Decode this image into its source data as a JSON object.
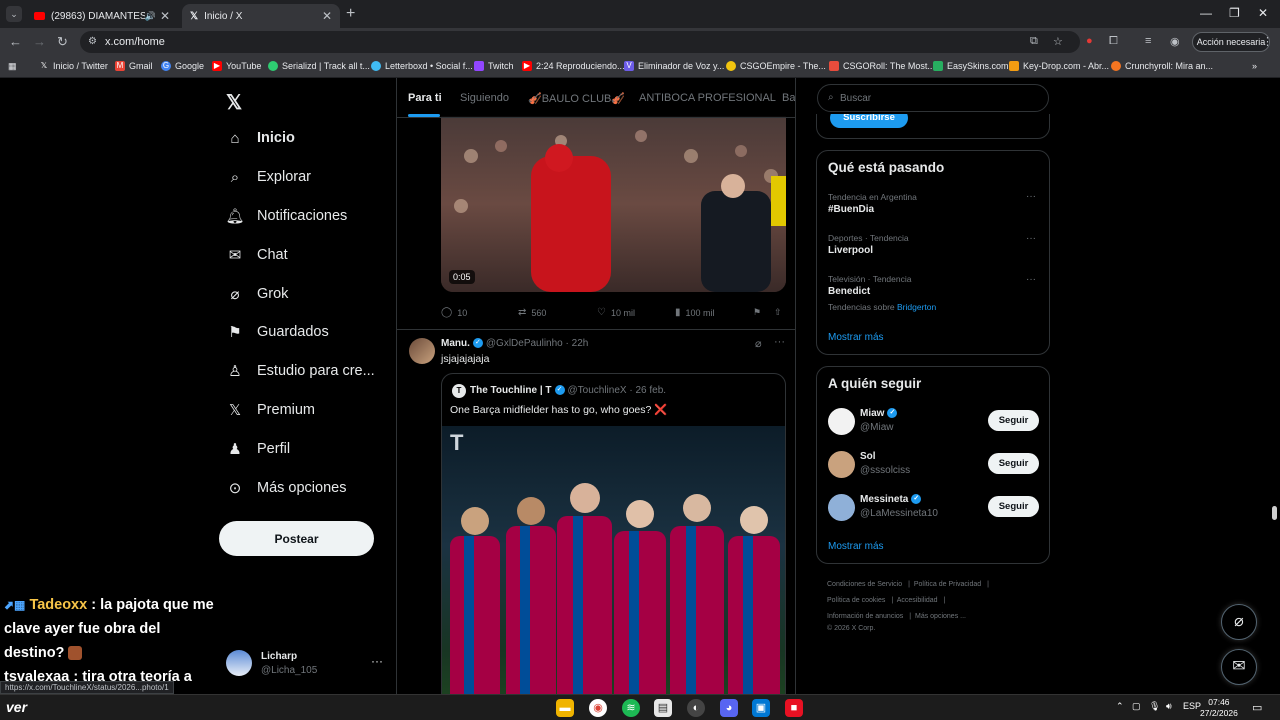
{
  "browser": {
    "tabs": [
      {
        "label": "(29863) DIAMANTES & KAL",
        "icon": "youtube-icon",
        "audio": "speaker-icon"
      },
      {
        "label": "Inicio / X",
        "icon": "x-icon"
      }
    ],
    "url": "x.com/home",
    "action_button": "Acción necesaria",
    "bookmarks": [
      {
        "label": "Inicio / Twitter",
        "color": "#000000"
      },
      {
        "label": "Gmail",
        "color": "#ea4335"
      },
      {
        "label": "Google",
        "color": "#4285f4"
      },
      {
        "label": "YouTube",
        "color": "#ff0000"
      },
      {
        "label": "Serializd | Track all t...",
        "color": "#2ecc71"
      },
      {
        "label": "Letterboxd • Social f...",
        "color": "#40bcf4"
      },
      {
        "label": "Twitch",
        "color": "#9146ff"
      },
      {
        "label": "2:24 Reproduciendo...",
        "color": "#ff0000"
      },
      {
        "label": "Eliminador de Voz y...",
        "color": "#6c5ce7"
      },
      {
        "label": "CSGOEmpire - The...",
        "color": "#f1c40f"
      },
      {
        "label": "CSGORoll: The Most...",
        "color": "#e74c3c"
      },
      {
        "label": "EasySkins.com",
        "color": "#27ae60"
      },
      {
        "label": "Key-Drop.com - Abr...",
        "color": "#f39c12"
      },
      {
        "label": "Crunchyroll: Mira an...",
        "color": "#f47521"
      }
    ],
    "status_url": "https://x.com/TouchlineX/status/2026...photo/1"
  },
  "nav": {
    "items": [
      "Inicio",
      "Explorar",
      "Notificaciones",
      "Chat",
      "Grok",
      "Guardados",
      "Estudio para cre...",
      "Premium",
      "Perfil",
      "Más opciones"
    ],
    "post_button": "Postear",
    "account": {
      "name": "Licharp",
      "handle": "@Licha_105"
    }
  },
  "chat_overlay": {
    "user1": "Tadeoxx",
    "msg1": ": la pajota que me clave ayer fue obra del destino?",
    "user2": "tsvalexaa",
    "msg2": ": tira otra teoría a"
  },
  "feed": {
    "tabs": [
      "Para ti",
      "Siguiendo",
      "🎻BAULO CLUB🎻",
      "ANTIBOCA PROFESIONAL",
      "Ba"
    ],
    "video_time": "0:05",
    "tweet1_actions": {
      "replies": "10",
      "reposts": "560",
      "likes": "10 mil",
      "views": "100 mil"
    },
    "tweet2": {
      "name": "Manu.",
      "handle": "@GxlDePaulinho",
      "time": "· 22h",
      "text": "jsjajajajaja",
      "quote": {
        "name": "The Touchline | T",
        "handle": "@TouchlineX",
        "time": "· 26 feb.",
        "text": "One Barça midfielder has to go, who goes? ❌"
      }
    }
  },
  "right": {
    "search_placeholder": "Buscar",
    "subscribe_button": "Suscribirse",
    "trending_title": "Qué está pasando",
    "trends": [
      {
        "meta": "Tendencia en Argentina",
        "name": "#BuenDia"
      },
      {
        "meta": "Deportes · Tendencia",
        "name": "Liverpool"
      },
      {
        "meta": "Televisión · Tendencia",
        "name": "Benedict",
        "extra": "Tendencias sobre",
        "extra_link": "Bridgerton"
      }
    ],
    "show_more": "Mostrar más",
    "follow_title": "A quién seguir",
    "follows": [
      {
        "name": "Miaw",
        "handle": "@Miaw",
        "verified": true,
        "color": "#f2f2f2"
      },
      {
        "name": "Sol",
        "handle": "@sssolciss",
        "verified": false,
        "color": "#c9a27e"
      },
      {
        "name": "Messineta",
        "handle": "@LaMessineta10",
        "verified": true,
        "color": "#8fb0d8"
      }
    ],
    "follow_button": "Seguir",
    "footer": [
      "Condiciones de Servicio",
      "Política de Privacidad",
      "Política de cookies",
      "Accesibilidad",
      "Información de anuncios",
      "Más opciones ...",
      "© 2026 X Corp."
    ]
  },
  "taskbar": {
    "logo": "ver",
    "lang": "ESP",
    "time": "07:46",
    "date": "27/2/2026"
  }
}
